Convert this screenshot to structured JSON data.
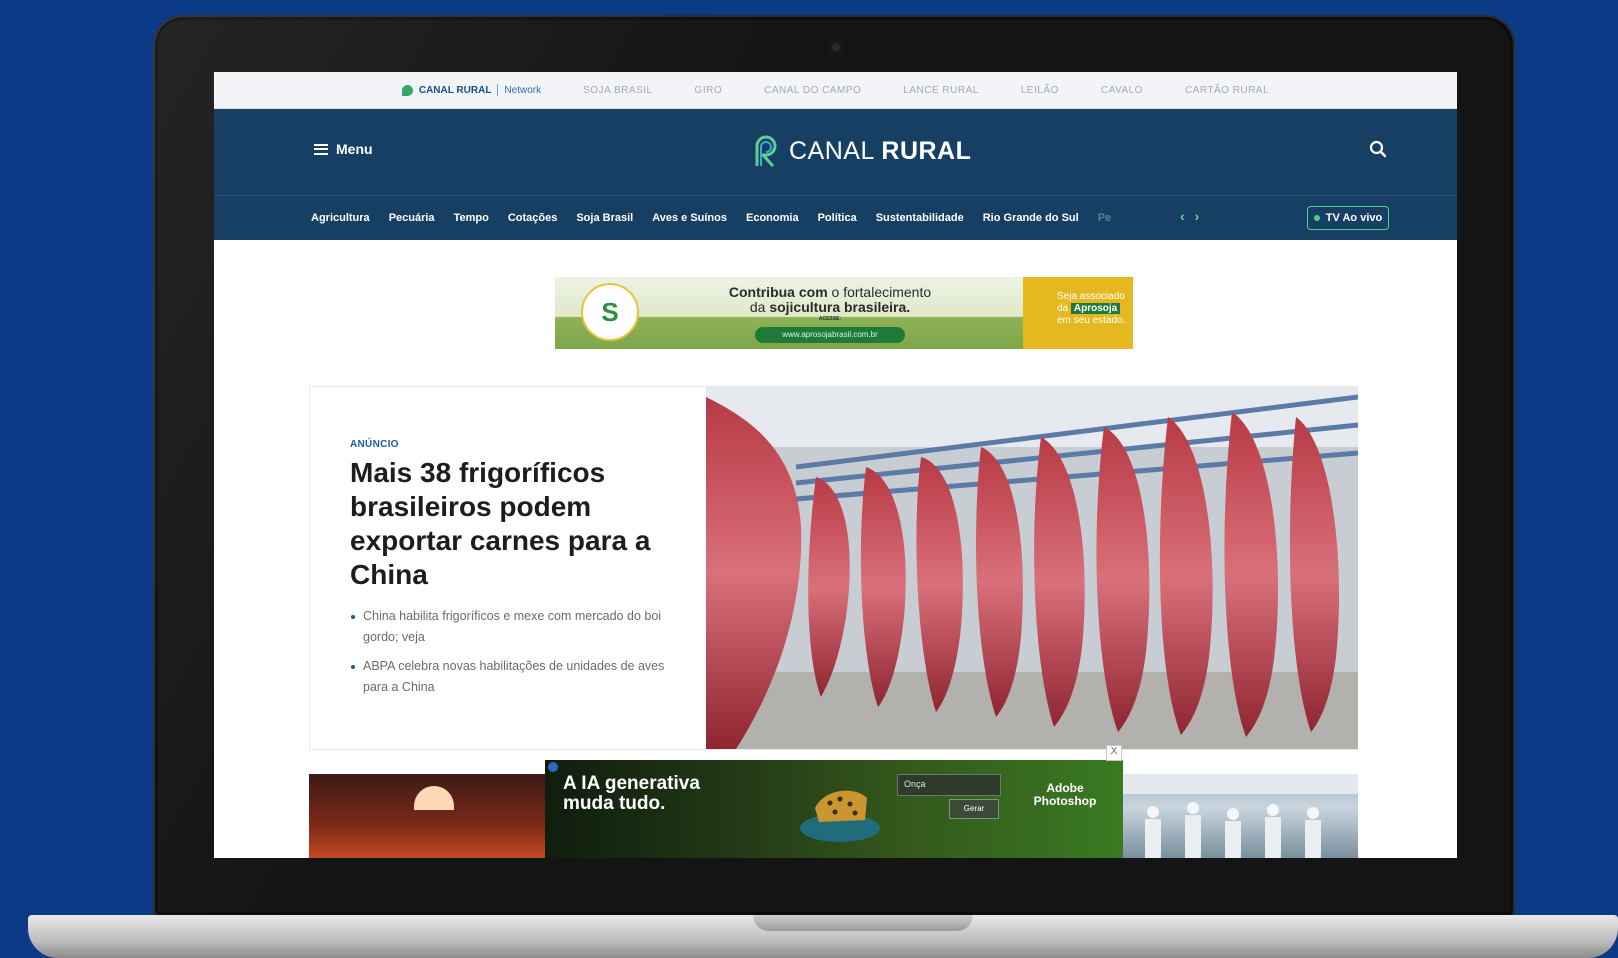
{
  "network_bar": {
    "brand": "CANAL RURAL",
    "network_label": "Network",
    "logos": [
      "SOJA BRASIL",
      "GIRO",
      "CANAL DO CAMPO",
      "LANCE RURAL",
      "LEILÃO",
      "CAVALO",
      "CARTÃO RURAL"
    ]
  },
  "header": {
    "menu_label": "Menu",
    "logo_thin": "CANAL",
    "logo_bold": "RURAL"
  },
  "nav": {
    "items": [
      "Agricultura",
      "Pecuária",
      "Tempo",
      "Cotações",
      "Soja Brasil",
      "Aves e Suínos",
      "Economia",
      "Política",
      "Sustentabilidade",
      "Rio Grande do Sul",
      "Pe"
    ],
    "prev": "‹",
    "next": "›",
    "tv_label": "TV Ao vivo"
  },
  "ad_banner": {
    "seal_letter": "S",
    "line1_bold": "Contribua com",
    "line1_rest": " o fortalecimento",
    "line2_pre": "da ",
    "line2_bold": "sojicultura brasileira.",
    "access": "ACESSE:",
    "url": "www.aprosojabrasil.com.br",
    "right_line1": "Seja associado",
    "right_pre": "da ",
    "right_highlight": "Aprosoja",
    "right_line3": "em seu estado."
  },
  "feature": {
    "tag": "ANÚNCIO",
    "title": "Mais 38 frigoríficos brasileiros podem exportar carnes para a China",
    "related": [
      "China habilita frigoríficos e mexe com mercado do boi gordo; veja",
      "ABPA celebra novas habilitações de unidades de aves para a China"
    ]
  },
  "bottom_ad": {
    "headline_line1": "A IA generativa",
    "headline_line2": "muda tudo.",
    "field_text": "Onça",
    "button_label": "Gerar",
    "brand_line1": "Adobe",
    "brand_line2": "Photoshop",
    "close": "X"
  },
  "colors": {
    "background": "#0b3a86",
    "header": "#173f63",
    "accent_green": "#4fd17f",
    "tag_blue": "#1d5b99"
  }
}
